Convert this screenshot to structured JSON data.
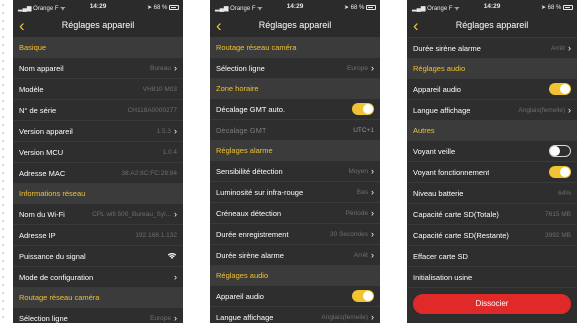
{
  "status_bar": {
    "carrier": "Orange F",
    "time": "14:29",
    "battery": "68 %"
  },
  "screen1": {
    "title": "Réglages appareil",
    "sections": {
      "basique": "Basique",
      "infos_reseau": "Informations réseau",
      "routage": "Routage réseau caméra"
    },
    "rows": {
      "nom_appareil": {
        "label": "Nom appareil",
        "value": "Bureau"
      },
      "modele": {
        "label": "Modèle",
        "value": "VH810 M03"
      },
      "serie": {
        "label": "N° de série",
        "value": "CH118A0000277"
      },
      "version_appareil": {
        "label": "Version appareil",
        "value": "1.5.3"
      },
      "version_mcu": {
        "label": "Version MCU",
        "value": "1.0.4"
      },
      "mac": {
        "label": "Adresse MAC",
        "value": "38:A2:8C:FC:28:84"
      },
      "wifi": {
        "label": "Nom du Wi-Fi",
        "value": "CPL wifi 500_Bureau_Syl..."
      },
      "ip": {
        "label": "Adresse IP",
        "value": "192.168.1.132"
      },
      "signal": {
        "label": "Puissance du signal"
      },
      "mode_config": {
        "label": "Mode de configuration"
      },
      "selection_ligne": {
        "label": "Sélection ligne",
        "value": "Europe"
      }
    }
  },
  "screen2": {
    "title": "Réglages appareil",
    "sections": {
      "routage": "Routage réseau caméra",
      "fuseau": "Zone horaire",
      "alarme": "Réglages alarme",
      "audio": "Réglages audio"
    },
    "rows": {
      "selection_ligne": {
        "label": "Sélection ligne",
        "value": "Europe"
      },
      "gmt_auto": {
        "label": "Décalage GMT auto.",
        "on": true
      },
      "gmt": {
        "label": "Décalage GMT",
        "value": "UTC+1"
      },
      "sensibilite": {
        "label": "Sensibilité détection",
        "value": "Moyen"
      },
      "luminosite": {
        "label": "Luminosité sur infra-rouge",
        "value": "Bas"
      },
      "creneaux": {
        "label": "Créneaux détection",
        "value": "Période"
      },
      "duree_enreg": {
        "label": "Durée enregistrement",
        "value": "30 Secondes"
      },
      "duree_sirene": {
        "label": "Durée sirène alarme",
        "value": "Arrêt"
      },
      "appareil_audio": {
        "label": "Appareil audio",
        "on": true
      },
      "langue": {
        "label": "Langue affichage",
        "value": "Anglais(femelle)"
      }
    }
  },
  "screen3": {
    "title": "Réglages appareil",
    "sections": {
      "audio": "Réglages audio",
      "autres": "Autres"
    },
    "rows": {
      "duree_sirene": {
        "label": "Durée sirène alarme",
        "value": "Arrêt"
      },
      "appareil_audio": {
        "label": "Appareil audio",
        "on": true
      },
      "langue": {
        "label": "Langue affichage",
        "value": "Anglais(femelle)"
      },
      "voyant_veille": {
        "label": "Voyant veille",
        "on": false
      },
      "voyant_fonct": {
        "label": "Voyant fonctionnement",
        "on": true
      },
      "batterie": {
        "label": "Niveau batterie",
        "value": "64%"
      },
      "sd_total": {
        "label": "Capacité carte SD(Totale)",
        "value": "7615 MB"
      },
      "sd_restante": {
        "label": "Capacité carte SD(Restante)",
        "value": "3992 MB"
      },
      "effacer_sd": {
        "label": "Effacer carte SD"
      },
      "init_usine": {
        "label": "Initialisation usine"
      }
    },
    "dissocier_label": "Dissocier"
  },
  "colors": {
    "accent": "#f1c232",
    "background": "#2e2e2e",
    "section_bg": "#3b3b3b",
    "danger": "#e02a2a"
  }
}
